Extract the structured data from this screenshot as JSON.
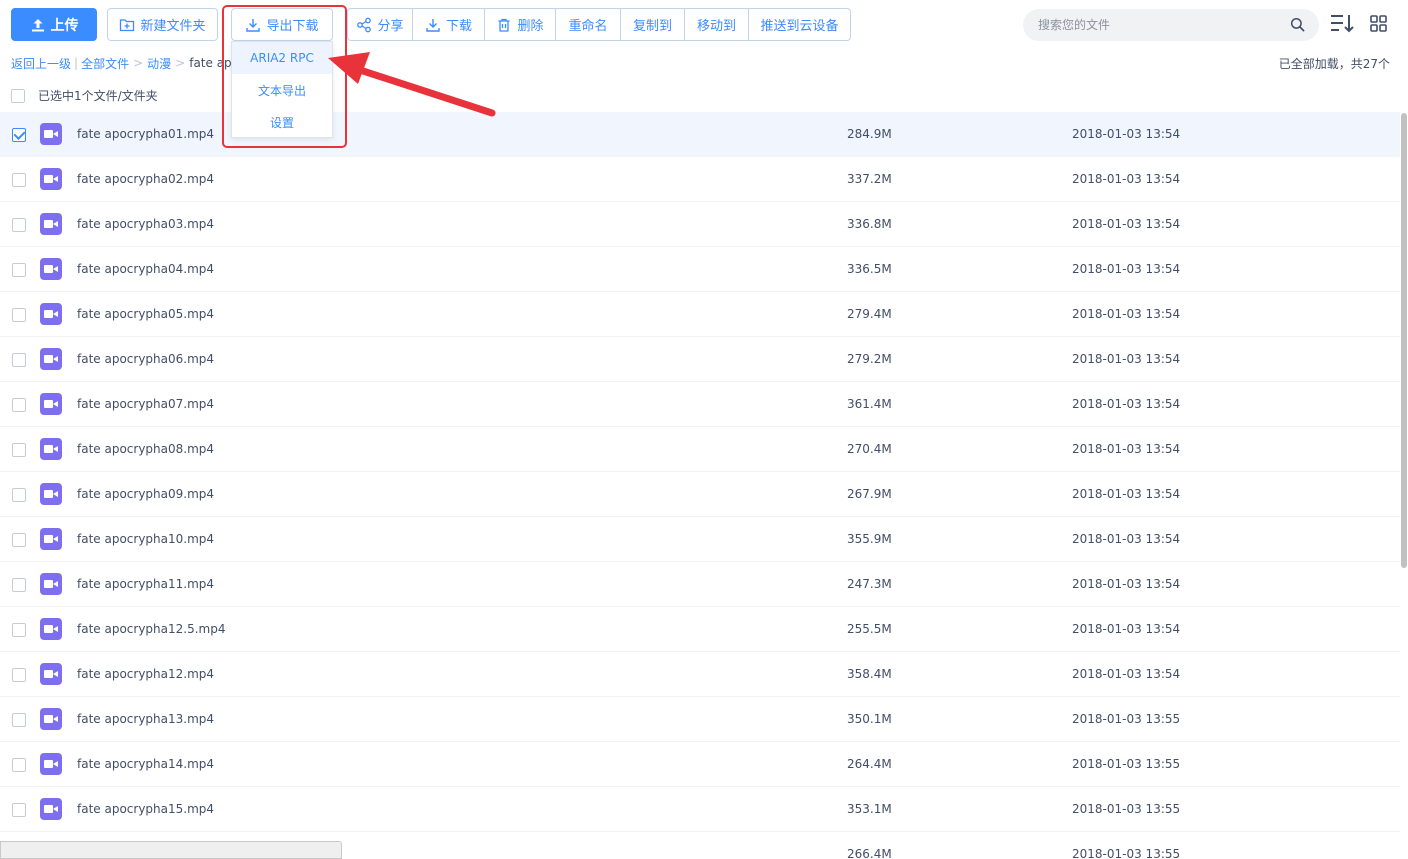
{
  "toolbar": {
    "upload_label": "上传",
    "new_folder_label": "新建文件夹",
    "export_label": "导出下载",
    "share_label": "分享",
    "download_label": "下载",
    "delete_label": "删除",
    "rename_label": "重命名",
    "copy_to_label": "复制到",
    "move_to_label": "移动到",
    "push_label": "推送到云设备",
    "accent_color": "#3b8cff"
  },
  "export_menu": {
    "items": [
      {
        "label": "ARIA2 RPC"
      },
      {
        "label": "文本导出"
      },
      {
        "label": "设置"
      }
    ]
  },
  "search": {
    "placeholder": "搜索您的文件"
  },
  "breadcrumb": {
    "back": "返回上一级",
    "divider": "|",
    "all_files": "全部文件",
    "arrow1": ">",
    "anime": "动漫",
    "arrow2": ">",
    "current": "fate apoc"
  },
  "status": {
    "loaded": "已全部加载，共27个",
    "selected": "已选中1个文件/文件夹"
  },
  "files": [
    {
      "name": "fate apocrypha01.mp4",
      "size": "284.9M",
      "time": "2018-01-03 13:54",
      "checked": true
    },
    {
      "name": "fate apocrypha02.mp4",
      "size": "337.2M",
      "time": "2018-01-03 13:54",
      "checked": false
    },
    {
      "name": "fate apocrypha03.mp4",
      "size": "336.8M",
      "time": "2018-01-03 13:54",
      "checked": false
    },
    {
      "name": "fate apocrypha04.mp4",
      "size": "336.5M",
      "time": "2018-01-03 13:54",
      "checked": false
    },
    {
      "name": "fate apocrypha05.mp4",
      "size": "279.4M",
      "time": "2018-01-03 13:54",
      "checked": false
    },
    {
      "name": "fate apocrypha06.mp4",
      "size": "279.2M",
      "time": "2018-01-03 13:54",
      "checked": false
    },
    {
      "name": "fate apocrypha07.mp4",
      "size": "361.4M",
      "time": "2018-01-03 13:54",
      "checked": false
    },
    {
      "name": "fate apocrypha08.mp4",
      "size": "270.4M",
      "time": "2018-01-03 13:54",
      "checked": false
    },
    {
      "name": "fate apocrypha09.mp4",
      "size": "267.9M",
      "time": "2018-01-03 13:54",
      "checked": false
    },
    {
      "name": "fate apocrypha10.mp4",
      "size": "355.9M",
      "time": "2018-01-03 13:54",
      "checked": false
    },
    {
      "name": "fate apocrypha11.mp4",
      "size": "247.3M",
      "time": "2018-01-03 13:54",
      "checked": false
    },
    {
      "name": "fate apocrypha12.5.mp4",
      "size": "255.5M",
      "time": "2018-01-03 13:54",
      "checked": false
    },
    {
      "name": "fate apocrypha12.mp4",
      "size": "358.4M",
      "time": "2018-01-03 13:54",
      "checked": false
    },
    {
      "name": "fate apocrypha13.mp4",
      "size": "350.1M",
      "time": "2018-01-03 13:55",
      "checked": false
    },
    {
      "name": "fate apocrypha14.mp4",
      "size": "264.4M",
      "time": "2018-01-03 13:55",
      "checked": false
    },
    {
      "name": "fate apocrypha15.mp4",
      "size": "353.1M",
      "time": "2018-01-03 13:55",
      "checked": false
    },
    {
      "name": "",
      "size": "266.4M",
      "time": "2018-01-03 13:55",
      "checked": false
    }
  ]
}
